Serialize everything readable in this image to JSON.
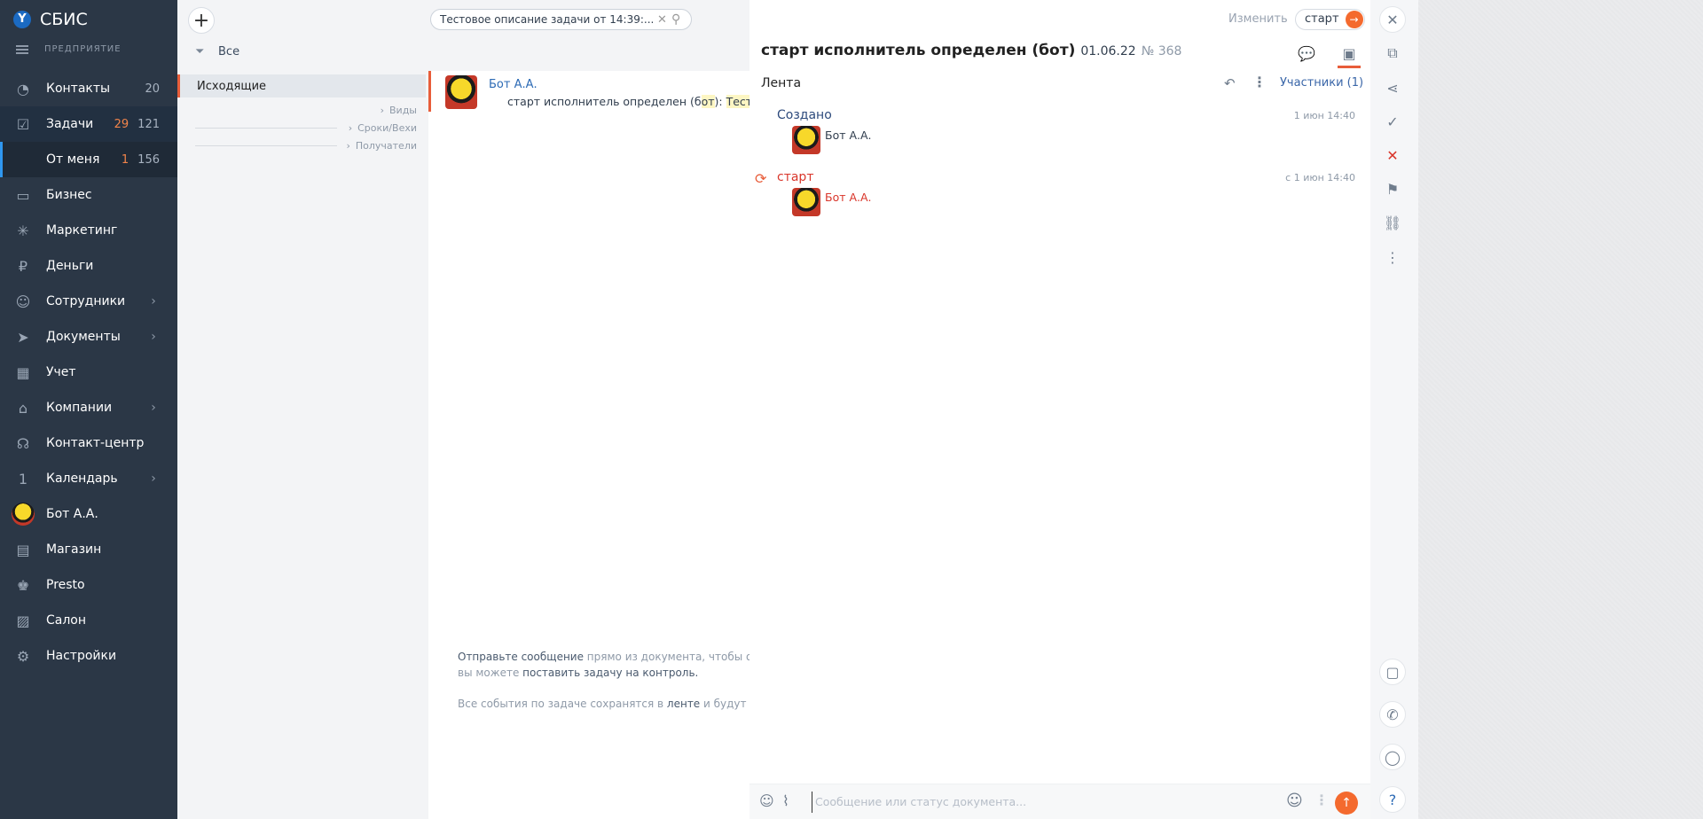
{
  "app": {
    "logo_text": "СБИС",
    "org_label": "ПРЕДПРИЯТИЕ"
  },
  "sidebar": {
    "items": [
      {
        "label": "Контакты",
        "count": "20",
        "icon": "contacts-icon"
      },
      {
        "label": "Задачи",
        "count_warn": "29",
        "count": "121",
        "icon": "tasks-icon"
      },
      {
        "label": "От меня",
        "count_warn": "1",
        "count": "156"
      },
      {
        "label": "Бизнес",
        "icon": "business-icon"
      },
      {
        "label": "Маркетинг",
        "icon": "marketing-icon"
      },
      {
        "label": "Деньги",
        "icon": "money-icon"
      },
      {
        "label": "Сотрудники",
        "icon": "employees-icon"
      },
      {
        "label": "Документы",
        "icon": "documents-icon"
      },
      {
        "label": "Учет",
        "icon": "accounting-icon"
      },
      {
        "label": "Компании",
        "icon": "companies-icon"
      },
      {
        "label": "Контакт-центр",
        "icon": "headset-icon"
      },
      {
        "label": "Календарь",
        "icon": "calendar-icon",
        "icon_text": "1"
      },
      {
        "label": "Бот А.А.",
        "icon": "avatar"
      },
      {
        "label": "Магазин",
        "icon": "shop-icon"
      },
      {
        "label": "Presto",
        "icon": "presto-icon"
      },
      {
        "label": "Салон",
        "icon": "salon-icon"
      },
      {
        "label": "Настройки",
        "icon": "settings-icon"
      }
    ]
  },
  "list": {
    "search_value": "Тестовое описание задачи от 14:39:...",
    "filter_label": "Все",
    "folder_active": "Исходящие",
    "folder_subs": [
      "Виды",
      "Сроки/Вехи",
      "Получатели"
    ],
    "task": {
      "author": "Бот А.А.",
      "text_prefix": "старт исполнитель определен (б",
      "text_hl1": "от",
      "text_mid": "): ",
      "text_hl2": "Тестовое"
    },
    "hint": {
      "line1_link": "Отправьте сообщение",
      "line1_rest": " прямо из документа, чтобы об",
      "line2_pre": "вы можете ",
      "line2_link": "поставить задачу на контроль.",
      "line3_pre": "Все события по задаче сохранятся в ",
      "line3_link": "ленте",
      "line3_rest": " и будут ви"
    }
  },
  "card": {
    "edit_label": "Изменить",
    "status_label": "старт",
    "title": "старт исполнитель определен (бот)",
    "date": "01.06.22",
    "number": "№ 368",
    "feed_title": "Лента",
    "participants": "Участники (1)",
    "events": [
      {
        "title": "Создано",
        "time": "1 июн 14:40",
        "user": "Бот А.А.",
        "title_color": "#2d4a7c",
        "user_color": "#313e4e"
      },
      {
        "title": "старт",
        "time": "с 1 июн 14:40",
        "user": "Бот А.А.",
        "title_color": "#d9352a",
        "user_color": "#d9352a"
      }
    ],
    "composer_placeholder": "Сообщение или статус документа..."
  },
  "colors": {
    "accent": "#f46a2e",
    "sidebar_bg": "#2b3746",
    "link": "#2d6bb5",
    "danger": "#d9352a"
  }
}
